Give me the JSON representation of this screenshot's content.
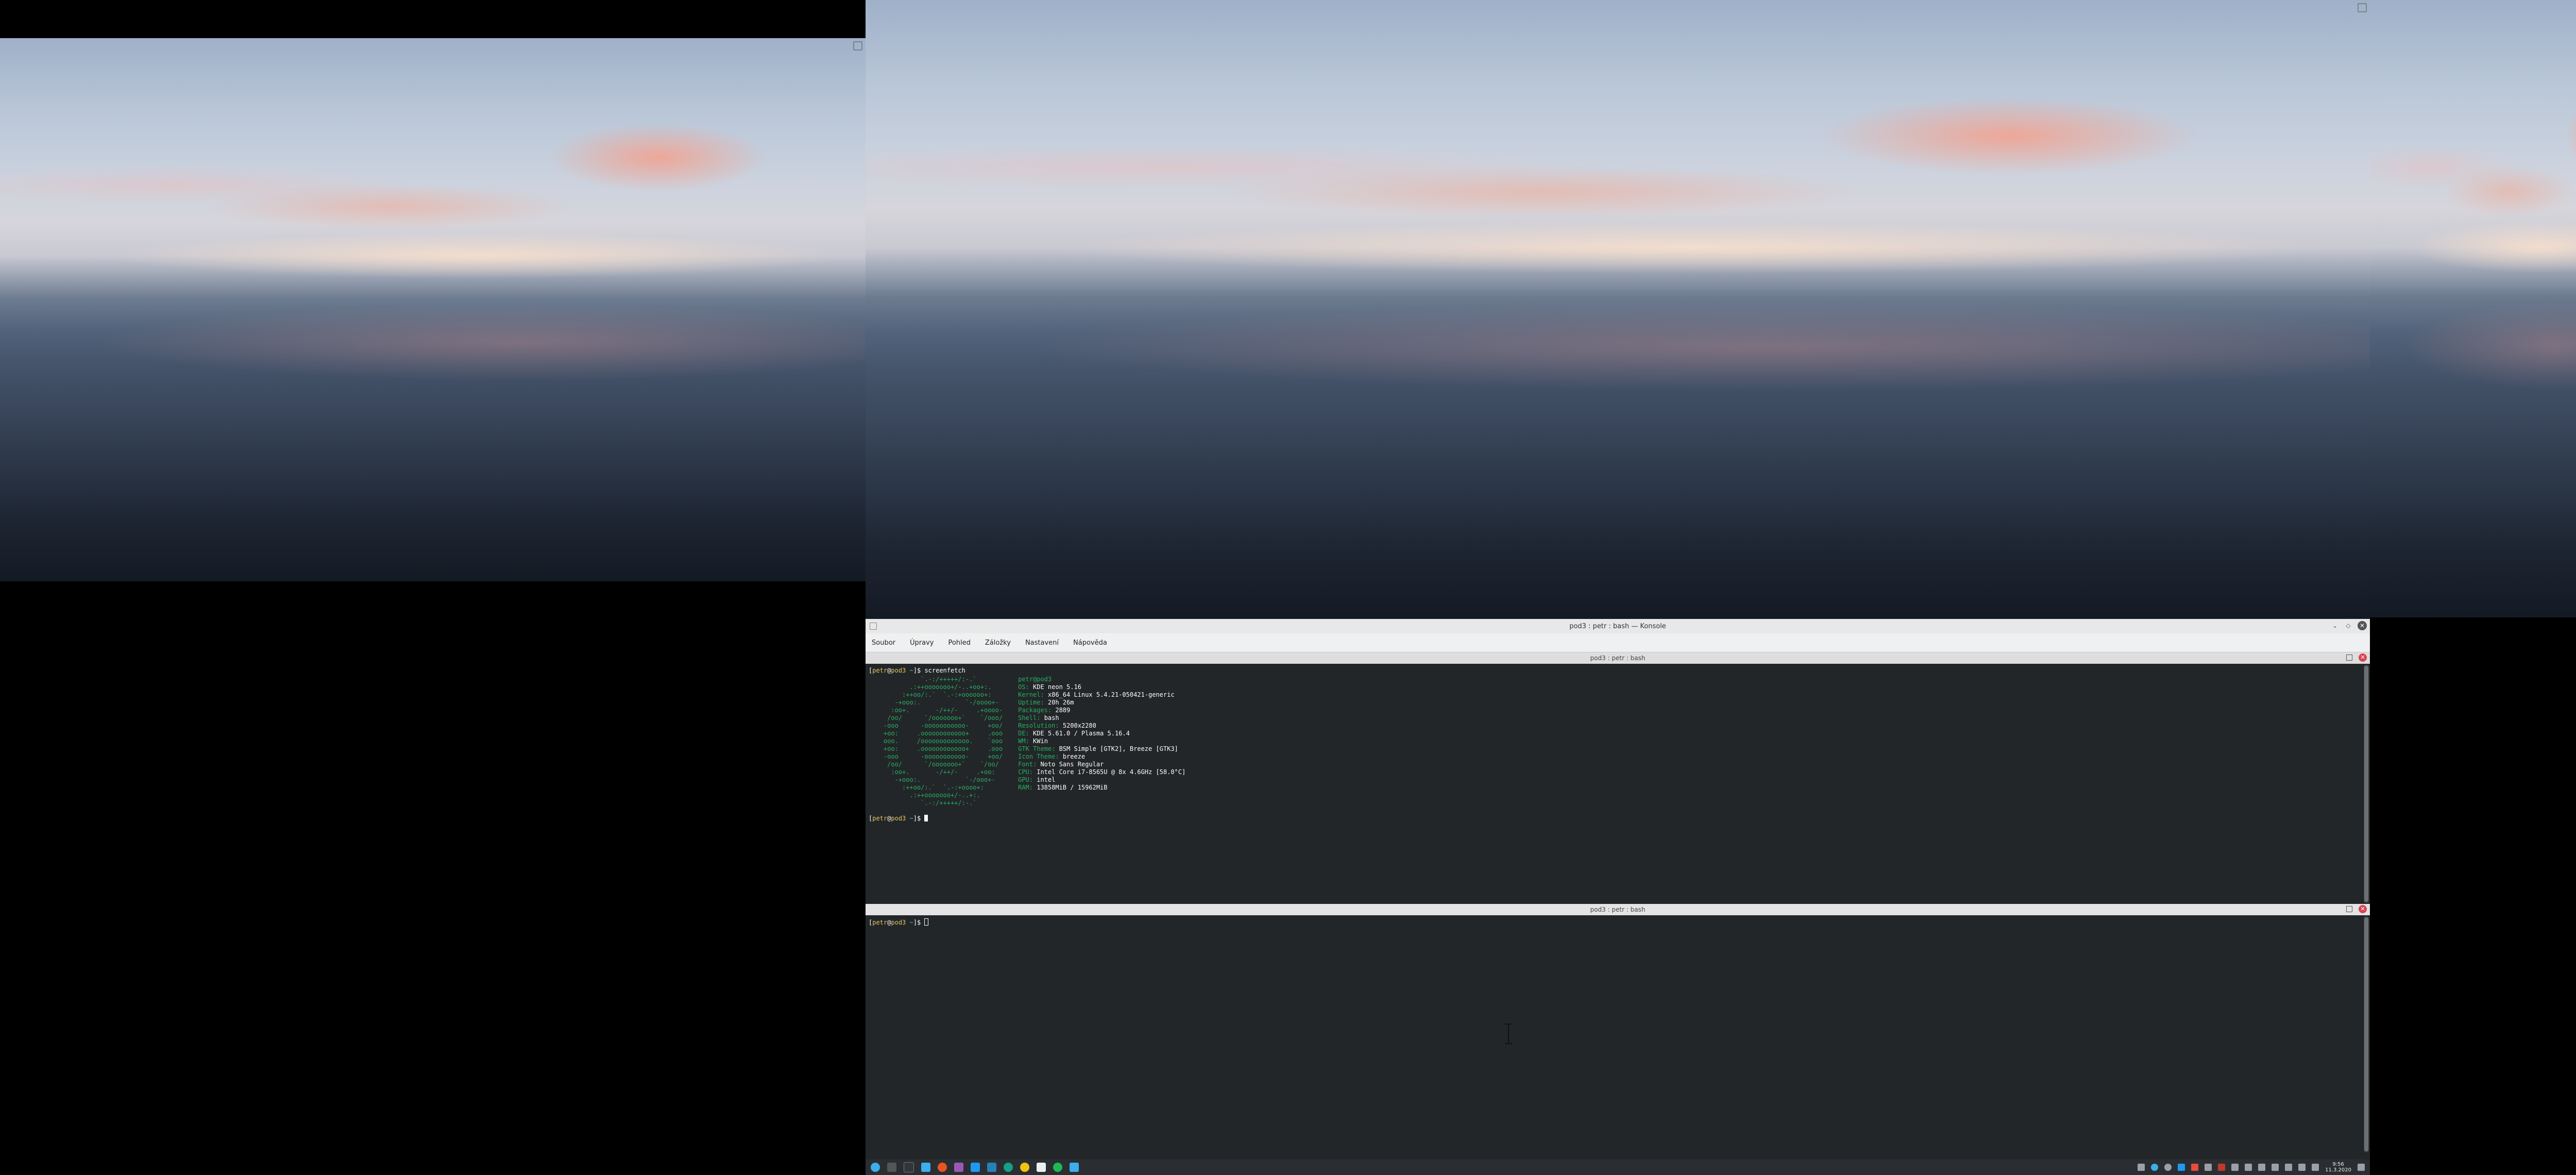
{
  "konsole": {
    "window_title": "pod3 : petr : bash — Konsole",
    "menu": [
      "Soubor",
      "Úpravy",
      "Pohled",
      "Záložky",
      "Nastavení",
      "Nápověda"
    ],
    "pane_top": {
      "title": "pod3 : petr : bash",
      "prompt1": {
        "user": "petr",
        "host": "pod3",
        "path": "~",
        "command": "screenfetch"
      },
      "ascii_art": [
        "              `.-:/+++++/:-.`",
        "           .:++ooooooo+/-..+oo+:.",
        "         :++oo/:.`  `.-:+oooooo+:",
        "       -+ooo:.            `-/oooo+-",
        "      :oo+.       -/++/-     .+oooo-",
        "     /oo/      `/ooooooo+`    `/ooo/",
        "    -ooo      -ooooooooooo-     +oo/",
        "    +oo:     .oooooooooooo+     .ooo",
        "    ooo.     /ooooooooooooo.    `ooo",
        "    +oo:     .oooooooooooo+     .ooo",
        "    -ooo      -ooooooooooo-     +oo/",
        "     /oo/      `/ooooooo+`    `/oo/",
        "      :oo+.       -/++/-     .+oo:",
        "       -+ooo:.            `-/ooo+-",
        "         :++oo/:.`  `.-:+oooo+:",
        "           .:++ooooooo+/-..+:.",
        "              `.-:/+++++/:-.`"
      ],
      "info_title": "petr@pod3",
      "info": [
        {
          "key": "OS:",
          "value": "KDE neon 5.16"
        },
        {
          "key": "Kernel:",
          "value": "x86_64 Linux 5.4.21-050421-generic"
        },
        {
          "key": "Uptime:",
          "value": "20h 26m"
        },
        {
          "key": "Packages:",
          "value": "2889"
        },
        {
          "key": "Shell:",
          "value": "bash"
        },
        {
          "key": "Resolution:",
          "value": "5200x2280"
        },
        {
          "key": "DE:",
          "value": "KDE 5.61.0 / Plasma 5.16.4"
        },
        {
          "key": "WM:",
          "value": "KWin"
        },
        {
          "key": "GTK Theme:",
          "value": "BSM Simple [GTK2], Breeze [GTK3]"
        },
        {
          "key": "Icon Theme:",
          "value": "breeze"
        },
        {
          "key": "Font:",
          "value": "Noto Sans Regular"
        },
        {
          "key": "CPU:",
          "value": "Intel Core i7-8565U @ 8x 4.6GHz [58.0°C]"
        },
        {
          "key": "GPU:",
          "value": "intel"
        },
        {
          "key": "RAM:",
          "value": "13858MiB / 15962MiB"
        }
      ],
      "prompt2": {
        "user": "petr",
        "host": "pod3",
        "path": "~"
      }
    },
    "pane_bottom": {
      "title": "pod3 : petr : bash",
      "prompt": {
        "user": "petr",
        "host": "pod3",
        "path": "~"
      }
    }
  },
  "taskbar": {
    "clock_time": "9:56",
    "clock_date": "11.3.2020"
  }
}
